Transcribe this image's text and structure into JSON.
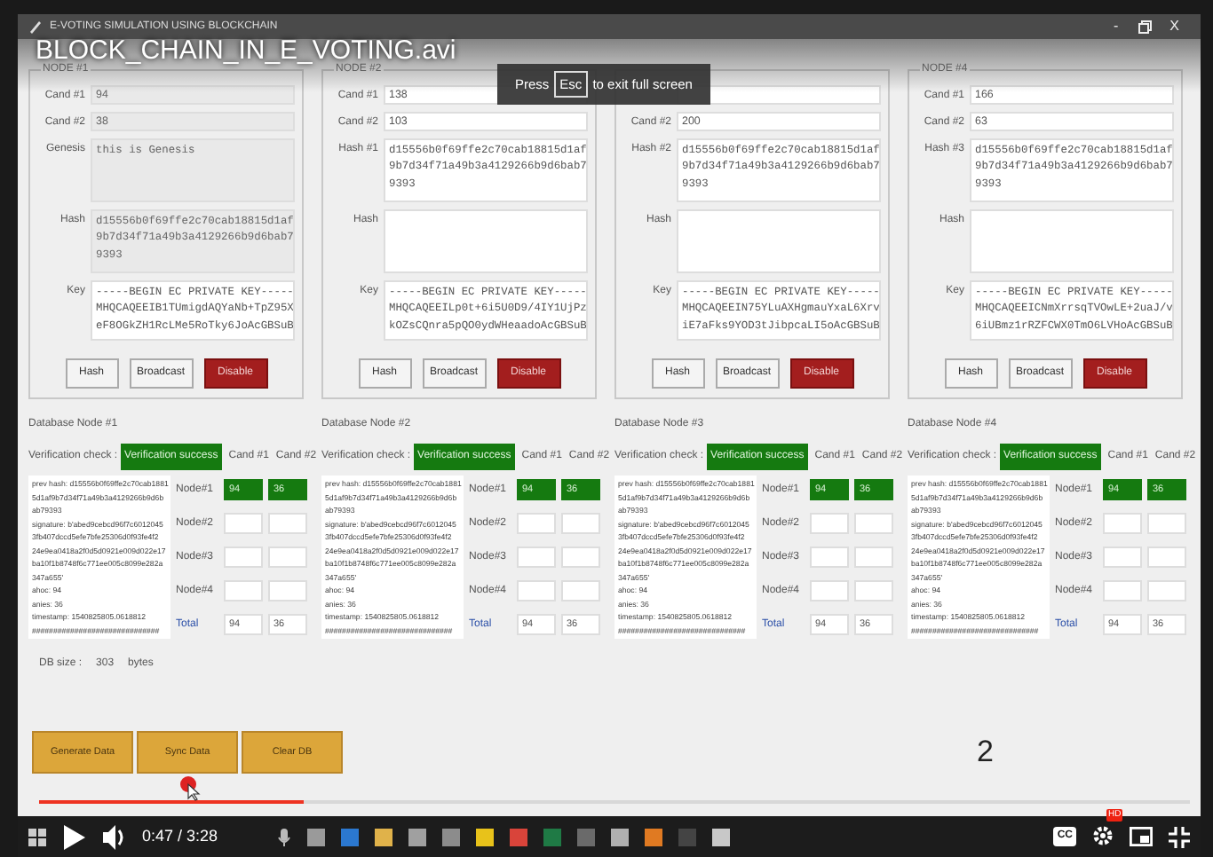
{
  "window": {
    "title": "E-VOTING SIMULATION USING BLOCKCHAIN",
    "minimize": "-",
    "close": "X"
  },
  "video": {
    "title": "BLOCK_CHAIN_IN_E_VOTING.avi"
  },
  "fullscreen_notice": {
    "before": "Press",
    "key": "Esc",
    "after": "to exit full screen"
  },
  "nodes": [
    {
      "title": "NODE #1",
      "fields": [
        {
          "label": "Cand #1",
          "value": "94",
          "kind": "line",
          "disabled": true
        },
        {
          "label": "Cand #2",
          "value": "38",
          "kind": "line",
          "disabled": true
        },
        {
          "label": "Genesis",
          "value": "this is Genesis",
          "kind": "box",
          "disabled": true
        },
        {
          "label": "Hash",
          "value": "d15556b0f69ffe2c70cab18815d1af\n9b7d34f71a49b3a4129266b9d6bab7\n9393",
          "kind": "box",
          "disabled": true
        },
        {
          "label": "Key",
          "value": "-----BEGIN EC PRIVATE KEY-----\nMHQCAQEEIB1TUmigdAQYaNb+TpZ95X\neF8OGkZH1RcLMe5RoTky6JoAcGBSuB",
          "kind": "box",
          "disabled": false
        }
      ],
      "buttons": [
        {
          "label": "Hash",
          "kind": "default"
        },
        {
          "label": "Broadcast",
          "kind": "default"
        },
        {
          "label": "Disable",
          "kind": "danger"
        }
      ]
    },
    {
      "title": "NODE #2",
      "fields": [
        {
          "label": "Cand #1",
          "value": "138",
          "kind": "line",
          "disabled": false
        },
        {
          "label": "Cand #2",
          "value": "103",
          "kind": "line",
          "disabled": false
        },
        {
          "label": "Hash #1",
          "value": "d15556b0f69ffe2c70cab18815d1af\n9b7d34f71a49b3a4129266b9d6bab7\n9393",
          "kind": "box",
          "disabled": false
        },
        {
          "label": "Hash",
          "kind": "box",
          "disabled": false
        },
        {
          "label": "Key",
          "value": "-----BEGIN EC PRIVATE KEY-----\nMHQCAQEEILp0t+6i5U0D9/4IY1UjPz\nkOZsCQnra5pQO0ydWHeaadoAcGBSuB",
          "kind": "box",
          "disabled": false
        }
      ],
      "buttons": [
        {
          "label": "Hash",
          "kind": "default"
        },
        {
          "label": "Broadcast",
          "kind": "default"
        },
        {
          "label": "Disable",
          "kind": "danger"
        }
      ]
    },
    {
      "fields": [
        {
          "kind": "line",
          "disabled": false
        },
        {
          "label": "Cand #2",
          "value": "200",
          "kind": "line",
          "disabled": false
        },
        {
          "label": "Hash #2",
          "value": "d15556b0f69ffe2c70cab18815d1af\n9b7d34f71a49b3a4129266b9d6bab7\n9393",
          "kind": "box",
          "disabled": false
        },
        {
          "label": "Hash",
          "kind": "box",
          "disabled": false
        },
        {
          "label": "Key",
          "value": "-----BEGIN EC PRIVATE KEY-----\nMHQCAQEEIN75YLuAXHgmauYxaL6Xrv\niE7aFks9YOD3tJibpcaLI5oAcGBSuB",
          "kind": "box",
          "disabled": false
        }
      ],
      "buttons": [
        {
          "label": "Hash",
          "kind": "default"
        },
        {
          "label": "Broadcast",
          "kind": "default"
        },
        {
          "label": "Disable",
          "kind": "danger"
        }
      ]
    },
    {
      "title": "NODE #4",
      "fields": [
        {
          "label": "Cand #1",
          "value": "166",
          "kind": "line",
          "disabled": false
        },
        {
          "label": "Cand #2",
          "value": "63",
          "kind": "line",
          "disabled": false
        },
        {
          "label": "Hash #3",
          "value": "d15556b0f69ffe2c70cab18815d1af\n9b7d34f71a49b3a4129266b9d6bab7\n9393",
          "kind": "box",
          "disabled": false
        },
        {
          "label": "Hash",
          "kind": "box",
          "disabled": false
        },
        {
          "label": "Key",
          "value": "-----BEGIN EC PRIVATE KEY-----\nMHQCAQEEICNmXrrsqTVOwLE+2uaJ/v\n6iUBmz1rRZFCWX0TmO6LVHoAcGBSuB",
          "kind": "box",
          "disabled": false
        }
      ],
      "buttons": [
        {
          "label": "Hash",
          "kind": "default"
        },
        {
          "label": "Broadcast",
          "kind": "default"
        },
        {
          "label": "Disable",
          "kind": "danger"
        }
      ]
    }
  ],
  "databases": [
    {
      "title": "Database Node #1",
      "check_label": "Verification check :",
      "status_text": "Verification success",
      "columns": [
        "Cand #1",
        "Cand #2"
      ],
      "ledger": [
        "prev hash: d15556b0f69ffe2c70cab1881",
        "5d1af9b7d34f71a49b3a4129266b9d6b",
        "ab79393",
        "signature: b'abed9cebcd96f7c6012045",
        "3fb407dccd5efe7bfe25306d0f93fe4f2",
        "24e9ea0418a2f0d5d0921e009d022e17",
        "ba10f1b8748f6c771ee005c8099e282a",
        "347a655'",
        "ahoc: 94",
        "anies: 36",
        "timestamp: 1540825805.0618812",
        "##############################"
      ],
      "rows": [
        {
          "label": "Node#1",
          "values": [
            "94",
            "36"
          ],
          "matched": true,
          "kind": "node"
        },
        {
          "label": "Node#2",
          "matched": false,
          "kind": "node"
        },
        {
          "label": "Node#3",
          "matched": false,
          "kind": "node"
        },
        {
          "label": "Node#4",
          "matched": false,
          "kind": "node"
        },
        {
          "label": "Total",
          "values": [
            "94",
            "36"
          ],
          "matched": false,
          "kind": "total"
        }
      ]
    },
    {
      "title": "Database Node #2",
      "check_label": "Verification check :",
      "status_text": "Verification success",
      "columns": [
        "Cand #1",
        "Cand #2"
      ],
      "ledger": [
        "prev hash: d15556b0f69ffe2c70cab1881",
        "5d1af9b7d34f71a49b3a4129266b9d6b",
        "ab79393",
        "signature: b'abed9cebcd96f7c6012045",
        "3fb407dccd5efe7bfe25306d0f93fe4f2",
        "24e9ea0418a2f0d5d0921e009d022e17",
        "ba10f1b8748f6c771ee005c8099e282a",
        "347a655'",
        "ahoc: 94",
        "anies: 36",
        "timestamp: 1540825805.0618812",
        "##############################"
      ],
      "rows": [
        {
          "label": "Node#1",
          "values": [
            "94",
            "36"
          ],
          "matched": true,
          "kind": "node"
        },
        {
          "label": "Node#2",
          "matched": false,
          "kind": "node"
        },
        {
          "label": "Node#3",
          "matched": false,
          "kind": "node"
        },
        {
          "label": "Node#4",
          "matched": false,
          "kind": "node"
        },
        {
          "label": "Total",
          "values": [
            "94",
            "36"
          ],
          "matched": false,
          "kind": "total"
        }
      ]
    },
    {
      "title": "Database Node #3",
      "check_label": "Verification check :",
      "status_text": "Verification success",
      "columns": [
        "Cand #1",
        "Cand #2"
      ],
      "ledger": [
        "prev hash: d15556b0f69ffe2c70cab1881",
        "5d1af9b7d34f71a49b3a4129266b9d6b",
        "ab79393",
        "signature: b'abed9cebcd96f7c6012045",
        "3fb407dccd5efe7bfe25306d0f93fe4f2",
        "24e9ea0418a2f0d5d0921e009d022e17",
        "ba10f1b8748f6c771ee005c8099e282a",
        "347a655'",
        "ahoc: 94",
        "anies: 36",
        "timestamp: 1540825805.0618812",
        "##############################"
      ],
      "rows": [
        {
          "label": "Node#1",
          "values": [
            "94",
            "36"
          ],
          "matched": true,
          "kind": "node"
        },
        {
          "label": "Node#2",
          "matched": false,
          "kind": "node"
        },
        {
          "label": "Node#3",
          "matched": false,
          "kind": "node"
        },
        {
          "label": "Node#4",
          "matched": false,
          "kind": "node"
        },
        {
          "label": "Total",
          "values": [
            "94",
            "36"
          ],
          "matched": false,
          "kind": "total"
        }
      ]
    },
    {
      "title": "Database Node #4",
      "check_label": "Verification check :",
      "status_text": "Verification success",
      "columns": [
        "Cand #1",
        "Cand #2"
      ],
      "ledger": [
        "prev hash: d15556b0f69ffe2c70cab1881",
        "5d1af9b7d34f71a49b3a4129266b9d6b",
        "ab79393",
        "signature: b'abed9cebcd96f7c6012045",
        "3fb407dccd5efe7bfe25306d0f93fe4f2",
        "24e9ea0418a2f0d5d0921e009d022e17",
        "ba10f1b8748f6c771ee005c8099e282a",
        "347a655'",
        "ahoc: 94",
        "anies: 36",
        "timestamp: 1540825805.0618812",
        "##############################"
      ],
      "rows": [
        {
          "label": "Node#1",
          "values": [
            "94",
            "36"
          ],
          "matched": true,
          "kind": "node"
        },
        {
          "label": "Node#2",
          "matched": false,
          "kind": "node"
        },
        {
          "label": "Node#3",
          "matched": false,
          "kind": "node"
        },
        {
          "label": "Node#4",
          "matched": false,
          "kind": "node"
        },
        {
          "label": "Total",
          "values": [
            "94",
            "36"
          ],
          "matched": false,
          "kind": "total"
        }
      ]
    }
  ],
  "db_size": {
    "label": "DB size :",
    "value": "303",
    "unit": "bytes"
  },
  "actions": [
    "Generate Data",
    "Sync Data",
    "Clear DB"
  ],
  "counter": "2",
  "player": {
    "level": 0.23,
    "time": "0:47 / 3:28",
    "cc": "CC",
    "quality_badge": "HD"
  },
  "taskbar": {
    "apps": [
      {
        "color": "#9a9a9a"
      },
      {
        "color": "#2b78d0"
      },
      {
        "color": "#e0b24a"
      },
      {
        "color": "#a0a0a0"
      },
      {
        "color": "#8c8c8c"
      },
      {
        "color": "#e8c21a"
      },
      {
        "color": "#d9443a"
      },
      {
        "color": "#1f7a45"
      },
      {
        "color": "#6a6a6a"
      },
      {
        "color": "#b0b0b0"
      },
      {
        "color": "#e07a22"
      },
      {
        "color": "#444444"
      },
      {
        "color": "#c8c8c8"
      }
    ]
  }
}
